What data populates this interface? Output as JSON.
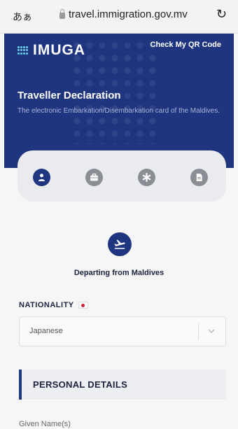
{
  "browser": {
    "aa_label": "あぁ",
    "url": "travel.immigration.gov.mv",
    "reload_icon": "reload-icon"
  },
  "header": {
    "logo_text": "IMUGA",
    "qr_link": "Check My QR Code",
    "title": "Traveller Declaration",
    "subtitle": "The electronic Embarkation/Disembarkation card of the Maldives."
  },
  "steps": [
    {
      "icon": "person-icon",
      "active": true
    },
    {
      "icon": "briefcase-icon",
      "active": false
    },
    {
      "icon": "asterisk-icon",
      "active": false
    },
    {
      "icon": "document-icon",
      "active": false
    }
  ],
  "trip": {
    "icon": "plane-icon",
    "label": "Departing from Maldives"
  },
  "nationality": {
    "label": "NATIONALITY",
    "flag": "japan-flag-icon",
    "selected": "Japanese"
  },
  "section": {
    "title": "PERSONAL DETAILS"
  },
  "fields": {
    "given_names_label": "Given Name(s)"
  },
  "colors": {
    "brand": "#1f3580",
    "logo_accent": "#6ad1e8",
    "inactive_step": "#8a8d93"
  }
}
